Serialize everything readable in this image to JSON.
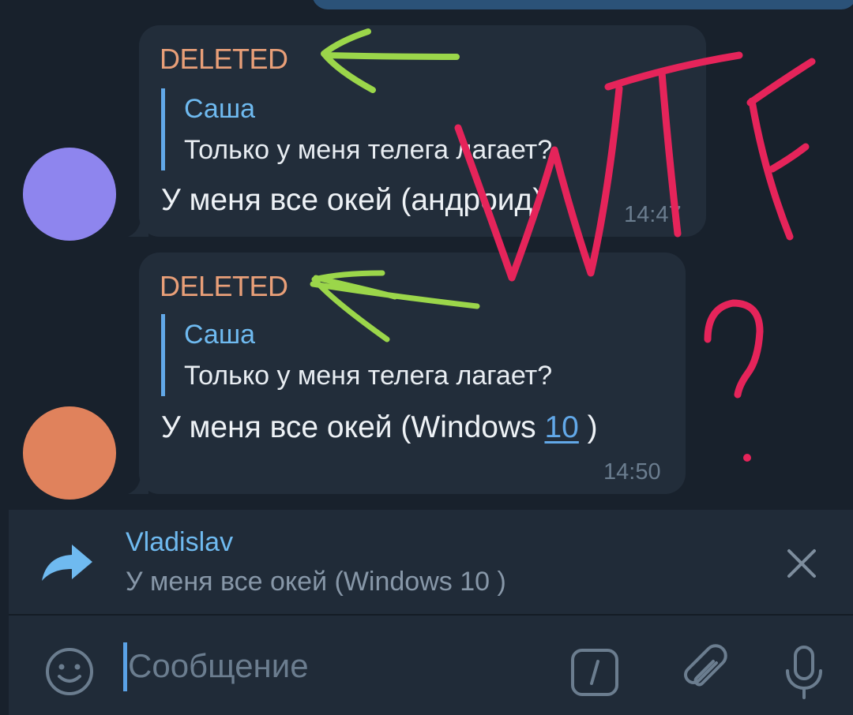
{
  "messages": [
    {
      "sender": "DELETED",
      "reply": {
        "name": "Саша",
        "text": "Только у меня телега лагает?"
      },
      "text": "У меня все окей (андроид)",
      "time": "14:47",
      "avatar_color": "#8e85ee"
    },
    {
      "sender": "DELETED",
      "reply": {
        "name": "Саша",
        "text": "Только у меня телега лагает?"
      },
      "text_before": "У меня все окей (Windows ",
      "text_link": "10",
      "text_after": " )",
      "time": "14:50",
      "avatar_color": "#e0825c"
    }
  ],
  "forward_panel": {
    "name": "Vladislav",
    "text": "У меня все окей (Windows 10 )",
    "icon": "forward-arrow-icon"
  },
  "composer": {
    "placeholder": "Сообщение",
    "icons": [
      "emoji-icon",
      "bot-command-icon",
      "attach-icon",
      "microphone-icon"
    ]
  },
  "annotations": {
    "handwritten_text": "WTF?",
    "arrow_color": "#9bd64a",
    "scribble_color": "#e5245a"
  },
  "colors": {
    "background": "#18212c",
    "bubble": "#222d3a",
    "accent": "#62a8e8",
    "sender": "#e99f78"
  }
}
